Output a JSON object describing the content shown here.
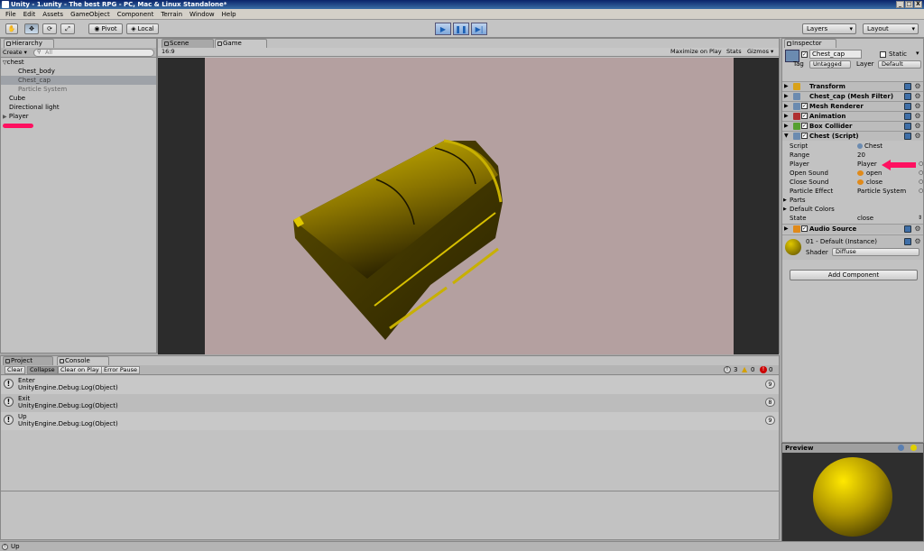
{
  "window": {
    "title": "Unity - 1.unity - The best RPG - PC, Mac & Linux Standalone*",
    "controls": [
      "_",
      "□",
      "X"
    ]
  },
  "menu": [
    "File",
    "Edit",
    "Assets",
    "GameObject",
    "Component",
    "Terrain",
    "Window",
    "Help"
  ],
  "toolbar": {
    "pivot": "Pivot",
    "local": "Local",
    "layers": "Layers",
    "layout": "Layout",
    "play_icon": "play-icon",
    "pause_icon": "pause-icon",
    "step_icon": "step-icon"
  },
  "hierarchy": {
    "tab": "Hierarchy",
    "create": "Create",
    "search_placeholder": "All",
    "items": [
      {
        "label": "chest",
        "indent": 0,
        "expander": "▽"
      },
      {
        "label": "Chest_body",
        "indent": 1
      },
      {
        "label": "Chest_cap",
        "indent": 1,
        "selected": true
      },
      {
        "label": "Particle System",
        "indent": 1,
        "dim": true
      },
      {
        "label": "Cube",
        "indent": 0
      },
      {
        "label": "Directional light",
        "indent": 0
      },
      {
        "label": "Player",
        "indent": 0,
        "expander": "▶"
      }
    ]
  },
  "views": {
    "scene_tab": "Scene",
    "game_tab": "Game",
    "aspect": "16:9",
    "maximize": "Maximize on Play",
    "stats": "Stats",
    "gizmos": "Gizmos"
  },
  "bottom": {
    "project_tab": "Project",
    "console_tab": "Console",
    "clear": "Clear",
    "collapse": "Collapse",
    "clear_on_play": "Clear on Play",
    "error_pause": "Error Pause",
    "count_logs": "3",
    "count_warnings": "0",
    "count_errors": "0",
    "entries": [
      {
        "line1": "Enter",
        "line2": "UnityEngine.Debug:Log(Object)",
        "count": "9"
      },
      {
        "line1": "Exit",
        "line2": "UnityEngine.Debug:Log(Object)",
        "count": "8"
      },
      {
        "line1": "Up",
        "line2": "UnityEngine.Debug:Log(Object)",
        "count": "9"
      }
    ],
    "status": "Up"
  },
  "inspector": {
    "tab": "Inspector",
    "object_name": "Chest_cap",
    "static_label": "Static",
    "tag_label": "Tag",
    "tag_value": "Untagged",
    "layer_label": "Layer",
    "layer_value": "Default",
    "components": [
      {
        "name": "Transform",
        "checkbox": false,
        "color": "#d9a21a"
      },
      {
        "name": "Chest_cap (Mesh Filter)",
        "checkbox": false,
        "color": "#6b8bb0"
      },
      {
        "name": "Mesh Renderer",
        "checkbox": true,
        "color": "#6b8bb0"
      },
      {
        "name": "Animation",
        "checkbox": true,
        "color": "#b03030"
      },
      {
        "name": "Box Collider",
        "checkbox": true,
        "color": "#55a030"
      }
    ],
    "script": {
      "name": "Chest (Script)",
      "fields": [
        {
          "label": "Script",
          "value": "Chest",
          "icon": true
        },
        {
          "label": "Range",
          "value": "20"
        },
        {
          "label": "Player",
          "value": "Player"
        },
        {
          "label": "Open Sound",
          "value": "open",
          "icon": true
        },
        {
          "label": "Close Sound",
          "value": "close",
          "icon": true
        },
        {
          "label": "Particle Effect",
          "value": "Particle System"
        },
        {
          "label": "Parts",
          "value": "",
          "expander": true
        },
        {
          "label": "Default Colors",
          "value": "",
          "expander": true
        },
        {
          "label": "State",
          "value": "close",
          "dropdown": true
        }
      ]
    },
    "audio": "Audio Source",
    "material": {
      "name": "01 - Default (Instance)",
      "shader_label": "Shader",
      "shader_value": "Diffuse"
    },
    "add_component": "Add Component",
    "preview": "Preview"
  },
  "colors": {
    "game_bg": "#b4a0a0",
    "chest_light": "#c8b000",
    "chest_dark": "#3a3000",
    "annotation": "#ff1060"
  }
}
